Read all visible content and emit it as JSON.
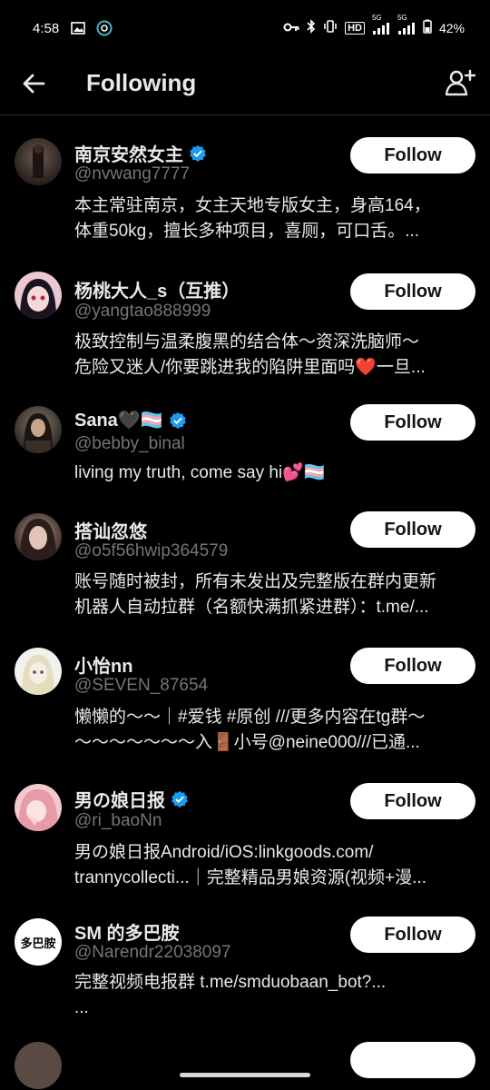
{
  "status": {
    "time": "4:58",
    "battery": "42%",
    "net1": "5G",
    "net2": "5G"
  },
  "header": {
    "title": "Following"
  },
  "follow_label": "Follow",
  "rows": [
    {
      "name": "南京安然女主",
      "handle": "@nvwang7777",
      "bio1": "本主常驻南京，女主天地专版女主，身高164，",
      "bio2": "体重50kg，擅长多种项目，喜厕，可口舌。..."
    },
    {
      "name": "杨桃大人_s（互推）",
      "handle": "@yangtao888999",
      "bio1": "极致控制与温柔腹黑的结合体～资深洗脑师～",
      "bio2": "危险又迷人/你要跳进我的陷阱里面吗❤️一旦..."
    },
    {
      "name": "Sana🖤🏳️‍⚧️",
      "handle": "@bebby_binal",
      "bio1": "living my truth, come say hi💕🏳️‍⚧️",
      "bio2": ""
    },
    {
      "name": "搭讪忽悠",
      "handle": "@o5f56hwip364579",
      "bio1": "账号随时被封，所有未发出及完整版在群内更新",
      "bio2": "机器人自动拉群（名额快满抓紧进群）：t.me/..."
    },
    {
      "name": "小怡nn",
      "handle": "@SEVEN_87654",
      "bio1": "懒懒的～～｜#爱钱 #原创 ///更多内容在tg群～",
      "bio2": "～～～～～～～入🚪小号@neine000///已通..."
    },
    {
      "name": "男の娘日报",
      "handle": "@ri_baoNn",
      "bio1": "男の娘日报Android/iOS:linkgoods.com/",
      "bio2": "trannycollecti...｜完整精品男娘资源(视频+漫..."
    },
    {
      "name": "SM 的多巴胺",
      "handle": "@Narendr22038097",
      "bio1": "完整视频电报群 t.me/smduobaan_bot?...",
      "bio2": "..."
    }
  ],
  "avatar7_text": "多巴胺"
}
